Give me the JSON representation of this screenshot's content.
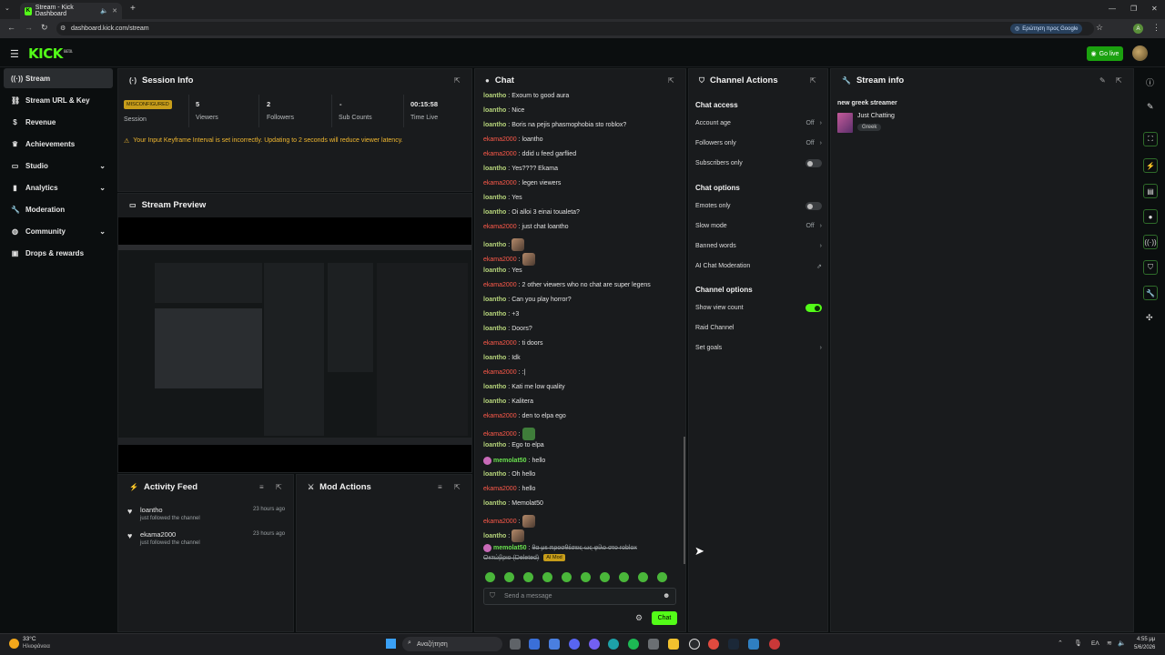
{
  "browser": {
    "tab_title": "Stream - Kick Dashboard",
    "url": "dashboard.kick.com/stream",
    "google_chip": "Ερώτηση προς Google",
    "profile_initial": "A"
  },
  "header": {
    "logo": "KICK",
    "logo_badge": "BETA",
    "go_live": "Go live"
  },
  "sidebar": {
    "items": [
      {
        "label": "Stream",
        "icon": "broadcast-icon",
        "active": true
      },
      {
        "label": "Stream URL & Key",
        "icon": "link-icon"
      },
      {
        "label": "Revenue",
        "icon": "dollar-icon"
      },
      {
        "label": "Achievements",
        "icon": "trophy-icon"
      },
      {
        "label": "Studio",
        "icon": "studio-icon",
        "chevron": true
      },
      {
        "label": "Analytics",
        "icon": "chart-icon",
        "chevron": true
      },
      {
        "label": "Moderation",
        "icon": "wrench-icon"
      },
      {
        "label": "Community",
        "icon": "globe-icon",
        "chevron": true
      },
      {
        "label": "Drops & rewards",
        "icon": "gift-icon"
      }
    ]
  },
  "session": {
    "title": "Session Info",
    "status_badge": "MISCONFIGURED",
    "status_label": "Session",
    "viewers_value": "5",
    "viewers_label": "Viewers",
    "followers_value": "2",
    "followers_label": "Followers",
    "subs_value": "-",
    "subs_label": "Sub Counts",
    "time_value": "00:15:58",
    "time_label": "Time Live",
    "warning": "Your Input Keyframe Interval is set incorrectly. Updating to 2 seconds will reduce viewer latency."
  },
  "preview": {
    "title": "Stream Preview"
  },
  "activity": {
    "title": "Activity Feed",
    "items": [
      {
        "user": "loantho",
        "time": "23 hours ago",
        "desc": "just followed the channel"
      },
      {
        "user": "ekama2000",
        "time": "23 hours ago",
        "desc": "just followed the channel"
      }
    ]
  },
  "mod_actions": {
    "title": "Mod Actions"
  },
  "chat": {
    "title": "Chat",
    "messages": [
      {
        "user": "loantho",
        "text": "Exoum to good aura",
        "cls": "u1"
      },
      {
        "user": "loantho",
        "text": "Nice",
        "cls": "u1"
      },
      {
        "user": "loantho",
        "text": "Boris na pejis phasmophobia sto roblox?",
        "cls": "u1"
      },
      {
        "user": "ekama2000",
        "text": "loantho",
        "cls": "u2"
      },
      {
        "user": "ekama2000",
        "text": "ddid u feed garflied",
        "cls": "u2"
      },
      {
        "user": "loantho",
        "text": "Yes???? Ekama",
        "cls": "u1"
      },
      {
        "user": "ekama2000",
        "text": "legen viewers",
        "cls": "u2"
      },
      {
        "user": "loantho",
        "text": "Yes",
        "cls": "u1"
      },
      {
        "user": "loantho",
        "text": "Oi alloi 3 einai toualeta?",
        "cls": "u1"
      },
      {
        "user": "ekama2000",
        "text": "just chat loantho",
        "cls": "u2"
      },
      {
        "user": "loantho",
        "text": "",
        "cls": "u1",
        "emote": true
      },
      {
        "user": "ekama2000",
        "text": "",
        "cls": "u2",
        "emote": true
      },
      {
        "user": "loantho",
        "text": "Yes",
        "cls": "u1"
      },
      {
        "user": "ekama2000",
        "text": "2 other viewers who no chat are super legens",
        "cls": "u2"
      },
      {
        "user": "loantho",
        "text": "Can you play horror?",
        "cls": "u1"
      },
      {
        "user": "loantho",
        "text": "+3",
        "cls": "u1"
      },
      {
        "user": "loantho",
        "text": "Doors?",
        "cls": "u1"
      },
      {
        "user": "ekama2000",
        "text": "ti doors",
        "cls": "u2"
      },
      {
        "user": "loantho",
        "text": "Idk",
        "cls": "u1"
      },
      {
        "user": "ekama2000",
        "text": ":|",
        "cls": "u2"
      },
      {
        "user": "loantho",
        "text": "Kati me low quality",
        "cls": "u1"
      },
      {
        "user": "loantho",
        "text": "Kalitera",
        "cls": "u1"
      },
      {
        "user": "ekama2000",
        "text": "den to elpa ego",
        "cls": "u2"
      },
      {
        "user": "ekama2000",
        "text": "",
        "cls": "u2",
        "emote": true,
        "green": true
      },
      {
        "user": "loantho",
        "text": "Ego to elpa",
        "cls": "u1"
      },
      {
        "user": "memolat50",
        "text": "hello",
        "cls": "u3",
        "badge": true
      },
      {
        "user": "loantho",
        "text": "Oh hello",
        "cls": "u1"
      },
      {
        "user": "ekama2000",
        "text": "hello",
        "cls": "u2"
      },
      {
        "user": "loantho",
        "text": "Memolat50",
        "cls": "u1"
      },
      {
        "user": "ekama2000",
        "text": "",
        "cls": "u2",
        "emote": true
      },
      {
        "user": "loantho",
        "text": "",
        "cls": "u1",
        "emote": true
      }
    ],
    "deleted": {
      "user": "memolat50",
      "line1": "θα με προσθέσεις ως φίλο στο roblox",
      "line2": "Οκτώβριο (Deleted)",
      "tag": "AI Mod"
    },
    "placeholder": "Send a message",
    "send": "Chat"
  },
  "channel_actions": {
    "title": "Channel Actions",
    "chat_access": "Chat access",
    "account_age": "Account age",
    "account_age_val": "Off",
    "followers_only": "Followers only",
    "followers_only_val": "Off",
    "subscribers_only": "Subscribers only",
    "chat_options": "Chat options",
    "emotes_only": "Emotes only",
    "slow_mode": "Slow mode",
    "slow_mode_val": "Off",
    "banned_words": "Banned words",
    "ai_mod": "AI Chat Moderation",
    "channel_options": "Channel options",
    "show_view_count": "Show view count",
    "raid": "Raid Channel",
    "set_goals": "Set goals"
  },
  "stream_info": {
    "title": "Stream info",
    "stream_title": "new greek streamer",
    "category": "Just Chatting",
    "tag": "Greek"
  },
  "taskbar": {
    "weather_temp": "33°C",
    "weather_desc": "Ηλιοφάνεια",
    "search": "Αναζήτηση",
    "lang": "ΕΛ",
    "time": "4:55 μμ",
    "date": "5/6/2026"
  }
}
